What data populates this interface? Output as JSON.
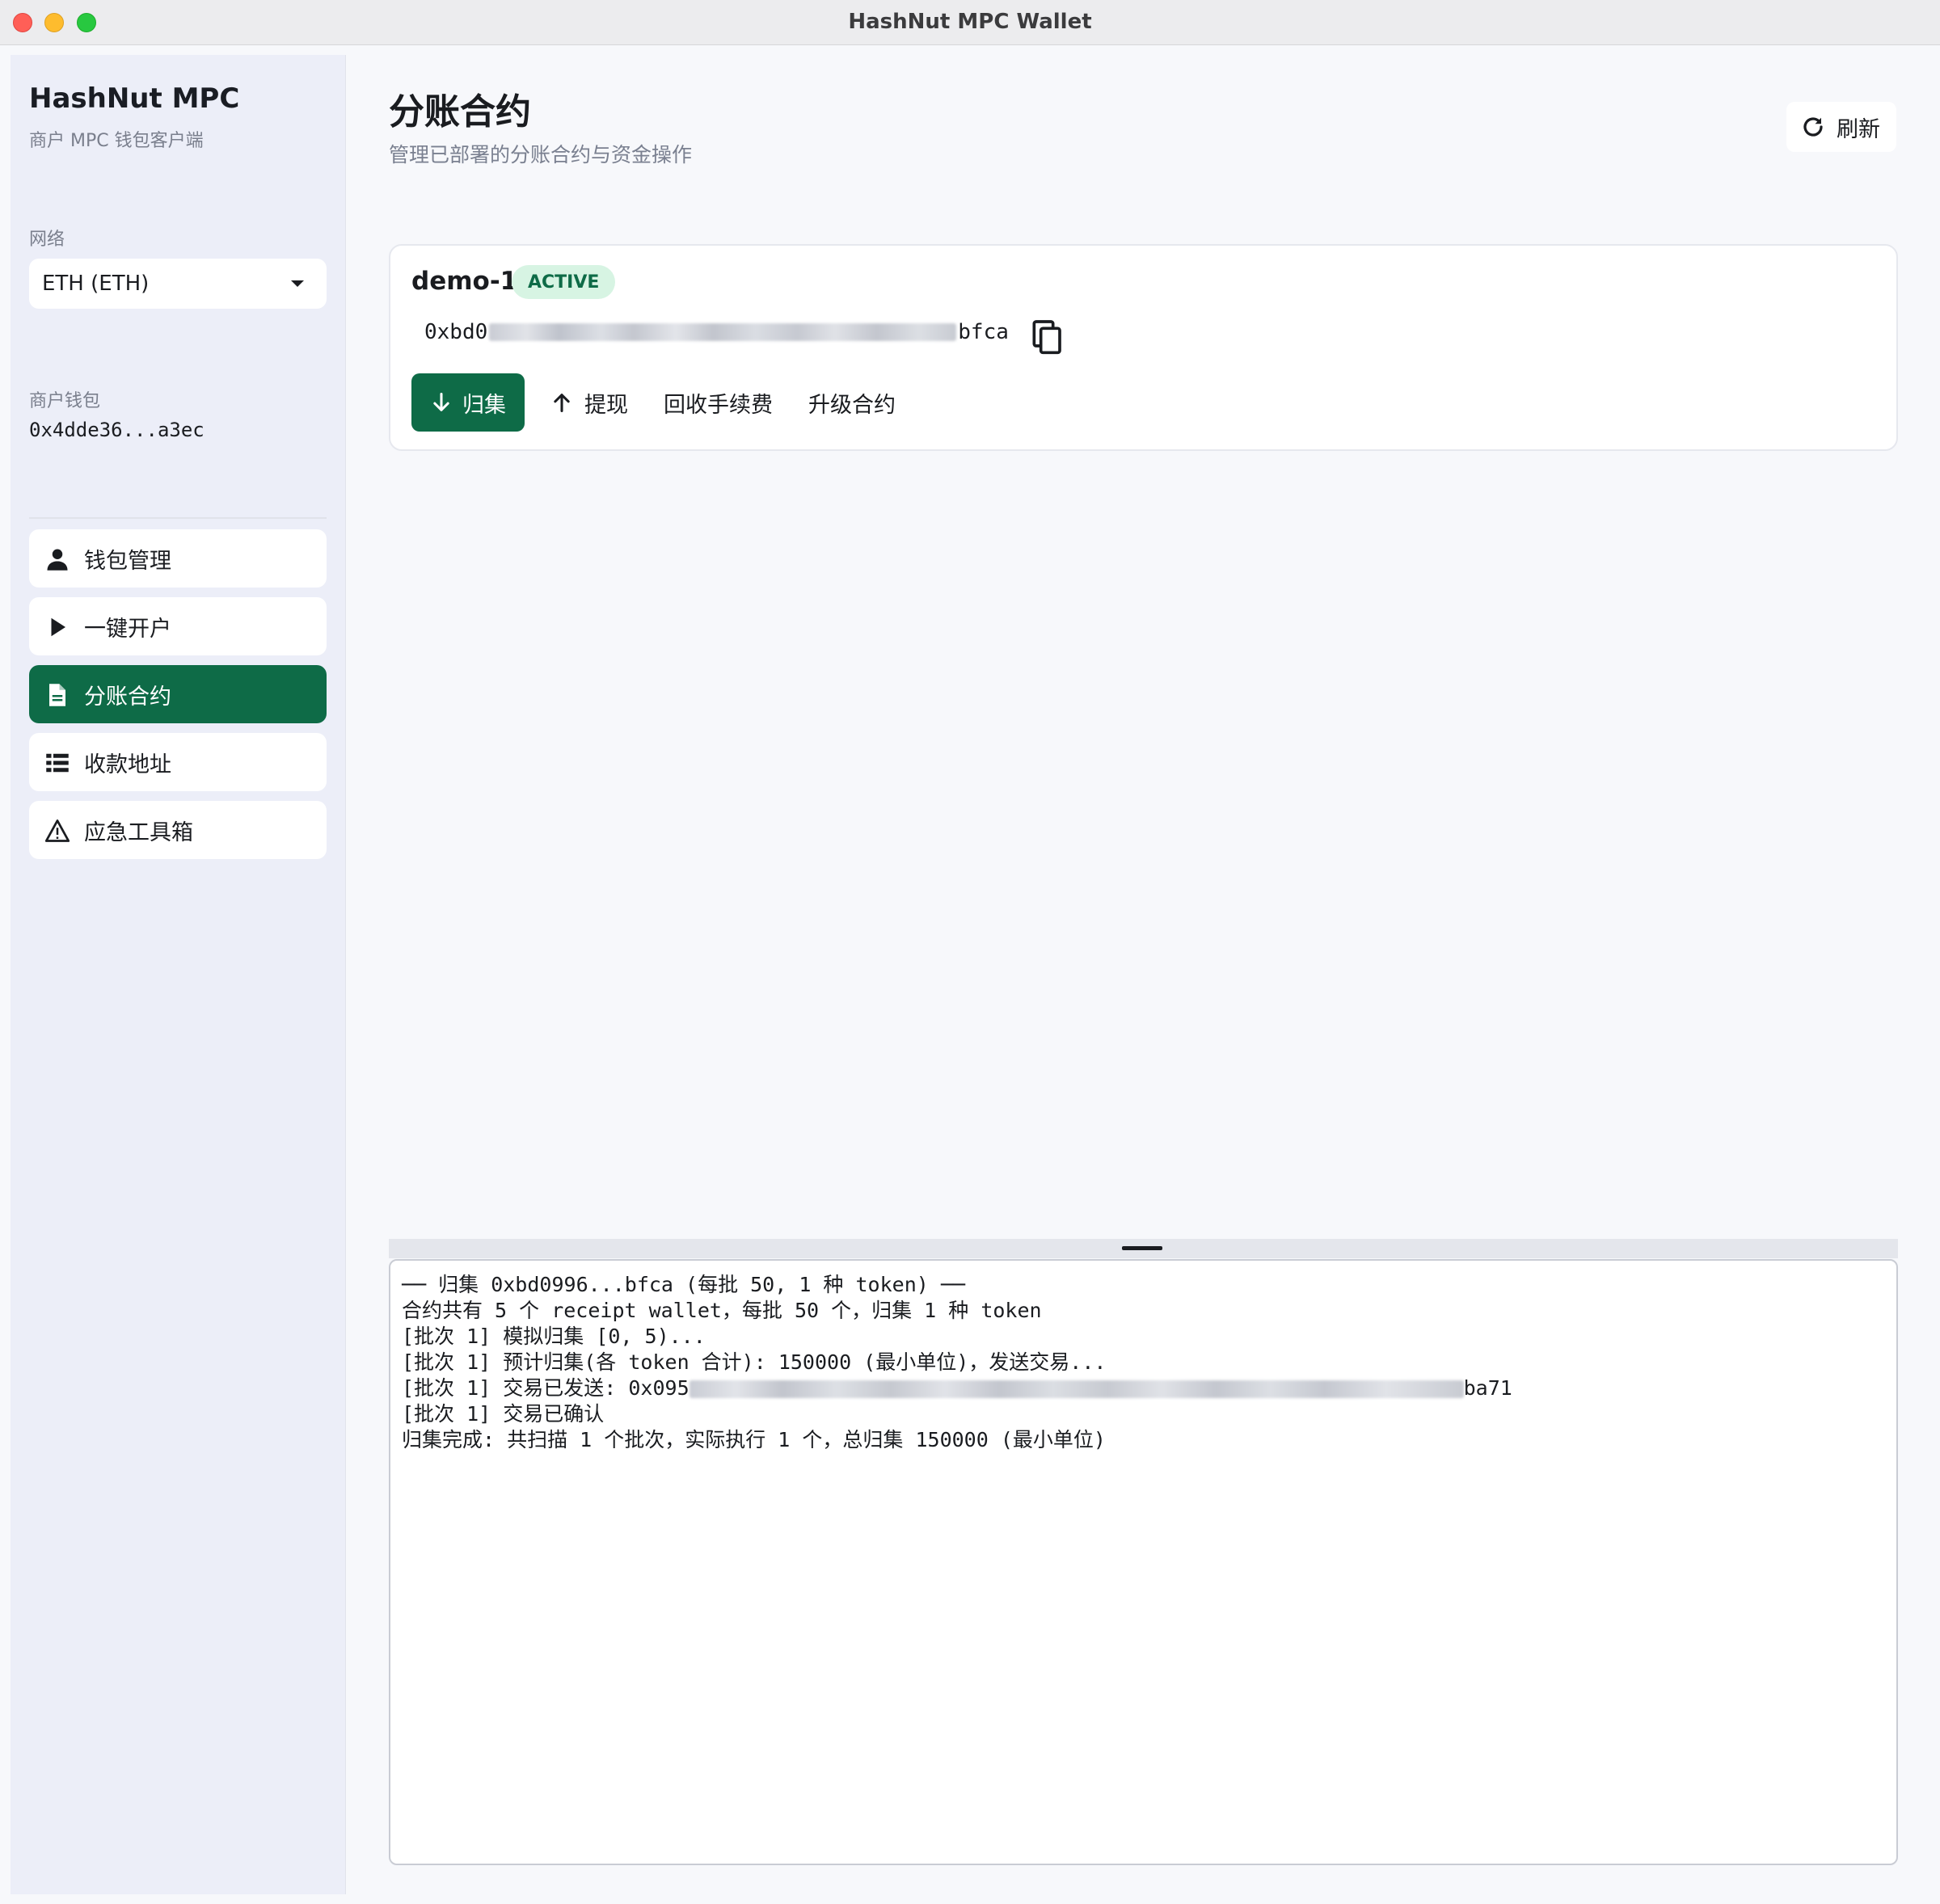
{
  "window": {
    "title": "HashNut MPC Wallet"
  },
  "sidebar": {
    "brand": "HashNut MPC",
    "brand_subtitle": "商户 MPC 钱包客户端",
    "network_label": "网络",
    "network_value": "ETH (ETH)",
    "wallet_label": "商户钱包",
    "wallet_address": "0x4dde36...a3ec",
    "items": [
      {
        "label": "钱包管理",
        "icon": "user-icon",
        "active": false
      },
      {
        "label": "一键开户",
        "icon": "play-icon",
        "active": false
      },
      {
        "label": "分账合约",
        "icon": "document-icon",
        "active": true
      },
      {
        "label": "收款地址",
        "icon": "list-icon",
        "active": false
      },
      {
        "label": "应急工具箱",
        "icon": "warning-icon",
        "active": false
      }
    ]
  },
  "header": {
    "title": "分账合约",
    "subtitle": "管理已部署的分账合约与资金操作",
    "refresh_label": "刷新"
  },
  "contract": {
    "name": "demo-1",
    "status": "ACTIVE",
    "address_prefix": "0xbd0",
    "address_suffix": "bfca",
    "actions": {
      "collect": "归集",
      "withdraw": "提现",
      "reclaim_fee": "回收手续费",
      "upgrade": "升级合约"
    }
  },
  "log": {
    "lines": [
      "── 归集 0xbd0996...bfca (每批 50, 1 种 token) ──",
      "合约共有 5 个 receipt wallet，每批 50 个，归集 1 种 token",
      "[批次 1] 模拟归集 [0, 5)...",
      "[批次 1] 预计归集(各 token 合计): 150000 (最小单位)，发送交易...",
      "[批次 1] 交易已发送: 0x095",
      "[批次 1] 交易已确认",
      "归集完成: 共扫描 1 个批次，实际执行 1 个，总归集 150000 (最小单位)"
    ],
    "tx_hash_suffix": "ba71"
  },
  "colors": {
    "accent": "#0e6b47",
    "badge_bg": "#d7f4e3",
    "sidebar_bg": "#eceef8"
  }
}
